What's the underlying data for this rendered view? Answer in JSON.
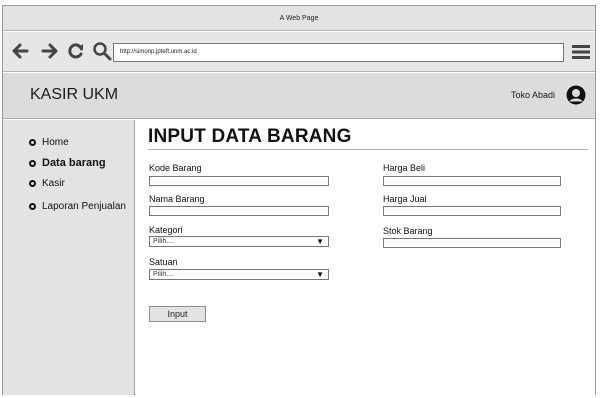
{
  "window": {
    "title": "A Web Page"
  },
  "browser": {
    "url": "http://simonp.jpteft.unm.ac.id"
  },
  "header": {
    "app_title": "KASIR UKM",
    "user_name": "Toko Abadi"
  },
  "sidebar": {
    "items": [
      {
        "label": "Home"
      },
      {
        "label": "Data barang"
      },
      {
        "label": "Kasir"
      },
      {
        "label": "Laporan Penjualan"
      }
    ]
  },
  "form": {
    "title": "INPUT DATA BARANG",
    "kode_barang_label": "Kode Barang",
    "nama_barang_label": "Nama Barang",
    "kategori_label": "Kategori",
    "kategori_value": "Pilih....",
    "satuan_label": "Satuan",
    "satuan_value": "Pilih....",
    "harga_beli_label": "Harga Beli",
    "harga_jual_label": "Harga Jual",
    "stok_barang_label": "Stok Barang",
    "submit_label": "Input"
  }
}
